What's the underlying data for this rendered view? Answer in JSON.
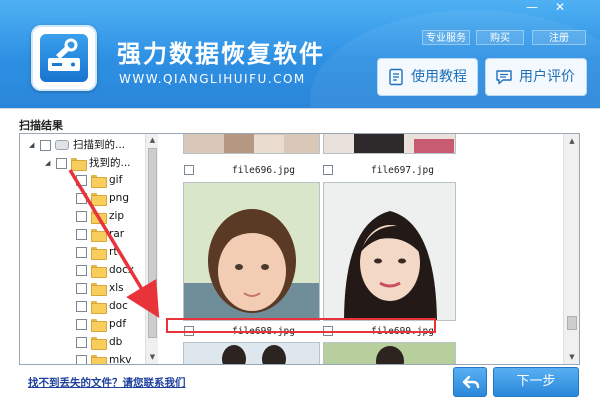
{
  "window": {
    "minimize_symbol": "—",
    "close_symbol": "✕"
  },
  "header": {
    "app_title": "强力数据恢复软件",
    "app_url": "WWW.QIANGLIHUIFU.COM",
    "top_links": {
      "service": "专业服务",
      "buy": "购买",
      "register": "注册"
    },
    "buttons": {
      "tutorial": "使用教程",
      "review": "用户评价"
    },
    "logo_icon": "disk-wrench-icon",
    "colors": {
      "header_top": "#4fb1f3",
      "header_bottom": "#2a86d9",
      "button_text": "#1e6fb8"
    }
  },
  "scan": {
    "section_title": "扫描结果",
    "tree": {
      "root": "扫描到的...",
      "found": "找到的...",
      "types": [
        "gif",
        "png",
        "zip",
        "rar",
        "rt",
        "docx",
        "xls",
        "doc",
        "pdf",
        "db",
        "mkv"
      ]
    },
    "files": [
      {
        "name": "file696.jpg"
      },
      {
        "name": "file697.jpg"
      },
      {
        "name": "file698.jpg"
      },
      {
        "name": "file699.jpg"
      }
    ]
  },
  "footer": {
    "help_link": "找不到丢失的文件？请您联系我们",
    "next_button": "下一步",
    "back_icon": "back-arrow-icon"
  },
  "annotation": {
    "arrow_color": "#e8333a",
    "highlight_color": "#e8333a"
  }
}
